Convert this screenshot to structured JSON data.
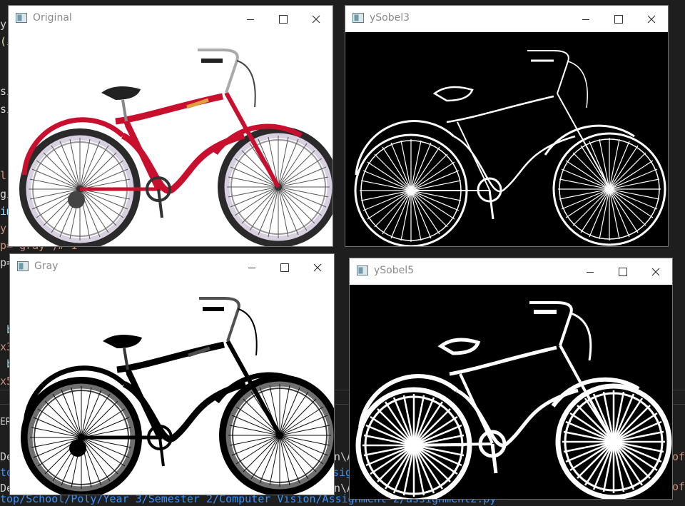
{
  "editor": {
    "code_fragments": [
      {
        "text": "y",
        "color": "#d4d4d4"
      },
      {
        "text": "(i",
        "color": "#dcdcaa"
      },
      {
        "text": "si",
        "color": "#d4d4d4"
      },
      {
        "text": "si",
        "color": "#d4d4d4"
      },
      {
        "text": "l'",
        "color": "#ce9178"
      },
      {
        "text": "gi",
        "color": "#d4d4d4"
      },
      {
        "text": "im",
        "color": "#9cdcfe"
      },
      {
        "text": "y'",
        "color": "#ce9178"
      },
      {
        "text": "p= gray')# 1",
        "color": "#ce9178"
      },
      {
        "text": "p=",
        "color": "#d4d4d4"
      },
      {
        "text": " b",
        "color": "#9cdcfe"
      },
      {
        "text": "x3",
        "color": "#ce9178"
      },
      {
        "text": " b",
        "color": "#9cdcfe"
      },
      {
        "text": "x5",
        "color": "#ce9178"
      }
    ],
    "terminal_fragments": [
      {
        "text": "ERM",
        "color": "#cccccc"
      },
      {
        "text": "De",
        "color": "#cccccc"
      },
      {
        "text": "to",
        "color": "#3794ff"
      },
      {
        "text": "De",
        "color": "#cccccc"
      },
      {
        "text": "top/School/Poly/Year 3/Semester 2/Computer Vision/Assignment 2/assignment2.py",
        "color": "#3794ff"
      }
    ],
    "right_fragments": [
      {
        "text": "of",
        "color": "#ce9178"
      },
      {
        "text": "of",
        "color": "#ce9178"
      }
    ],
    "middle_fragments": [
      {
        "text": "n\\A",
        "color": "#cccccc"
      },
      {
        "text": "sig",
        "color": "#3794ff"
      },
      {
        "text": "n\\A",
        "color": "#cccccc"
      }
    ]
  },
  "windows": {
    "original": {
      "title": "Original"
    },
    "ysobel3": {
      "title": "ySobel3"
    },
    "gray": {
      "title": "Gray"
    },
    "ysobel5": {
      "title": "ySobel5"
    }
  },
  "icons": {
    "app": "opencv-window-icon",
    "minimize": "minimize-icon",
    "maximize": "maximize-icon",
    "close": "close-icon"
  }
}
